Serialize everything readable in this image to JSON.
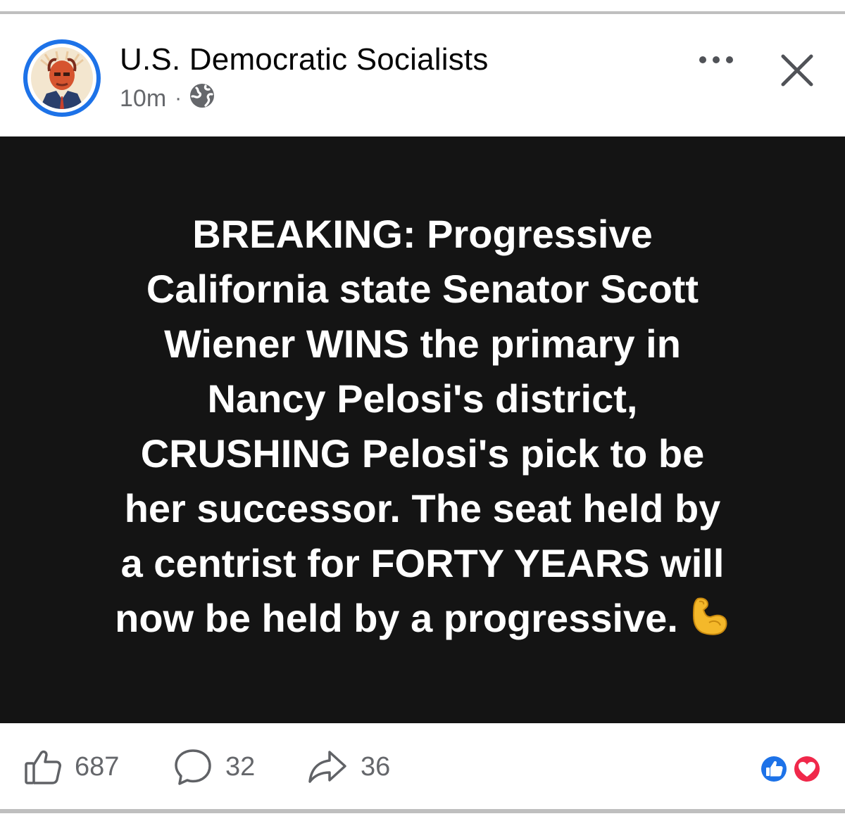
{
  "post": {
    "author": "U.S. Democratic Socialists",
    "time": "10m",
    "separator": "·",
    "privacy_icon": "globe-icon",
    "avatar_desc_icon": "profile-avatar",
    "body_lines": [
      "BREAKING: Progressive",
      "California state Senator Scott",
      "Wiener WINS the primary in",
      "Nancy Pelosi's district,",
      "CRUSHING Pelosi's pick to be",
      "her successor. The seat held by",
      "a centrist for FORTY YEARS will",
      "now be held by a progressive."
    ],
    "body_emoji": "flexed-biceps-emoji",
    "background_color": "#141414",
    "text_color": "#ffffff"
  },
  "header": {
    "more_icon": "more-options-icon",
    "close_icon": "close-icon"
  },
  "actions": {
    "likes": "687",
    "comments": "32",
    "shares": "36",
    "like_icon": "thumbs-up-icon",
    "comment_icon": "comment-bubble-icon",
    "share_icon": "share-arrow-icon",
    "reaction_icons": [
      "like-reaction-icon",
      "love-reaction-icon"
    ]
  },
  "colors": {
    "accent_blue": "#1d72e8",
    "love_red": "#f0284a",
    "muted_text": "#65676b"
  }
}
